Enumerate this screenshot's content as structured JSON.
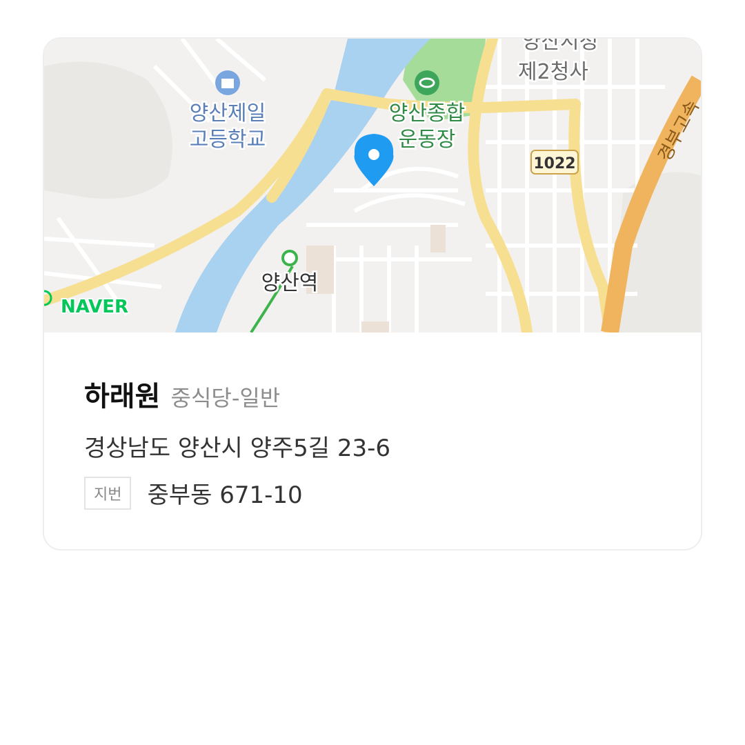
{
  "map": {
    "logo": "NAVER",
    "labels": {
      "school_line1": "양산제일",
      "school_line2": "고등학교",
      "stadium_line1": "양산종합",
      "stadium_line2": "운동장",
      "cityhall_line1": "양산시청",
      "cityhall_line2": "제2청사",
      "station": "양산역",
      "road_number": "1022",
      "expressway": "경부고속"
    },
    "pin_icon": "map-pin-icon",
    "colors": {
      "river": "#a9d1f0",
      "road": "#f7df92",
      "expressway": "#f0b45e",
      "park": "#a6dc9a",
      "pin": "#1f9bf2",
      "naver_green": "#03c75a"
    }
  },
  "place": {
    "name": "하래원",
    "category": "중식당-일반",
    "road_address": "경상남도 양산시 양주5길 23-6",
    "jibun_badge": "지번",
    "jibun_address": "중부동 671-10"
  }
}
